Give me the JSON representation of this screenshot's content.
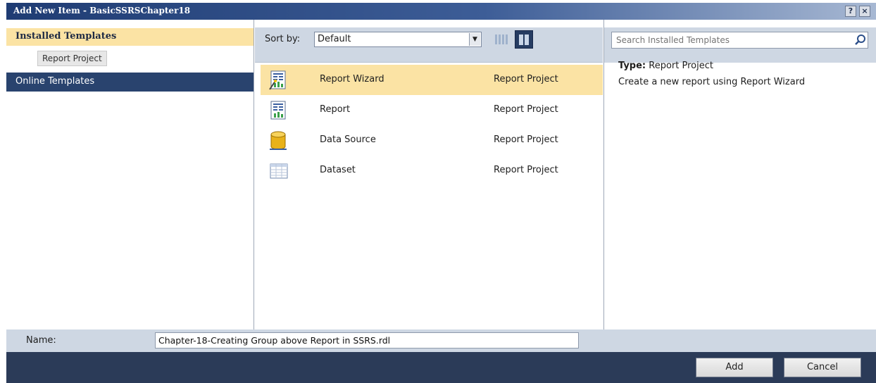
{
  "window": {
    "title": "Add New Item - BasicSSRSChapter18",
    "help_label": "?",
    "close_label": "×"
  },
  "left_panel": {
    "installed_templates": "Installed Templates",
    "report_project": "Report Project",
    "online_templates": "Online Templates"
  },
  "sort": {
    "label": "Sort by:",
    "value": "Default"
  },
  "templates": [
    {
      "name": "Report Wizard",
      "type": "Report Project",
      "icon": "report-wizard-icon",
      "selected": true
    },
    {
      "name": "Report",
      "type": "Report Project",
      "icon": "report-icon",
      "selected": false
    },
    {
      "name": "Data Source",
      "type": "Report Project",
      "icon": "data-source-icon",
      "selected": false
    },
    {
      "name": "Dataset",
      "type": "Report Project",
      "icon": "dataset-icon",
      "selected": false
    }
  ],
  "search": {
    "placeholder": "Search Installed Templates"
  },
  "details": {
    "type_label": "Type:",
    "type_value": "Report Project",
    "description": "Create a new report using Report Wizard"
  },
  "name_field": {
    "label": "Name:",
    "value": "Chapter-18-Creating Group above Report in SSRS.rdl"
  },
  "buttons": {
    "add": "Add",
    "cancel": "Cancel"
  },
  "colors": {
    "selection": "#fbe3a4",
    "header_dark": "#29436e",
    "panel_bar": "#ced7e3"
  }
}
